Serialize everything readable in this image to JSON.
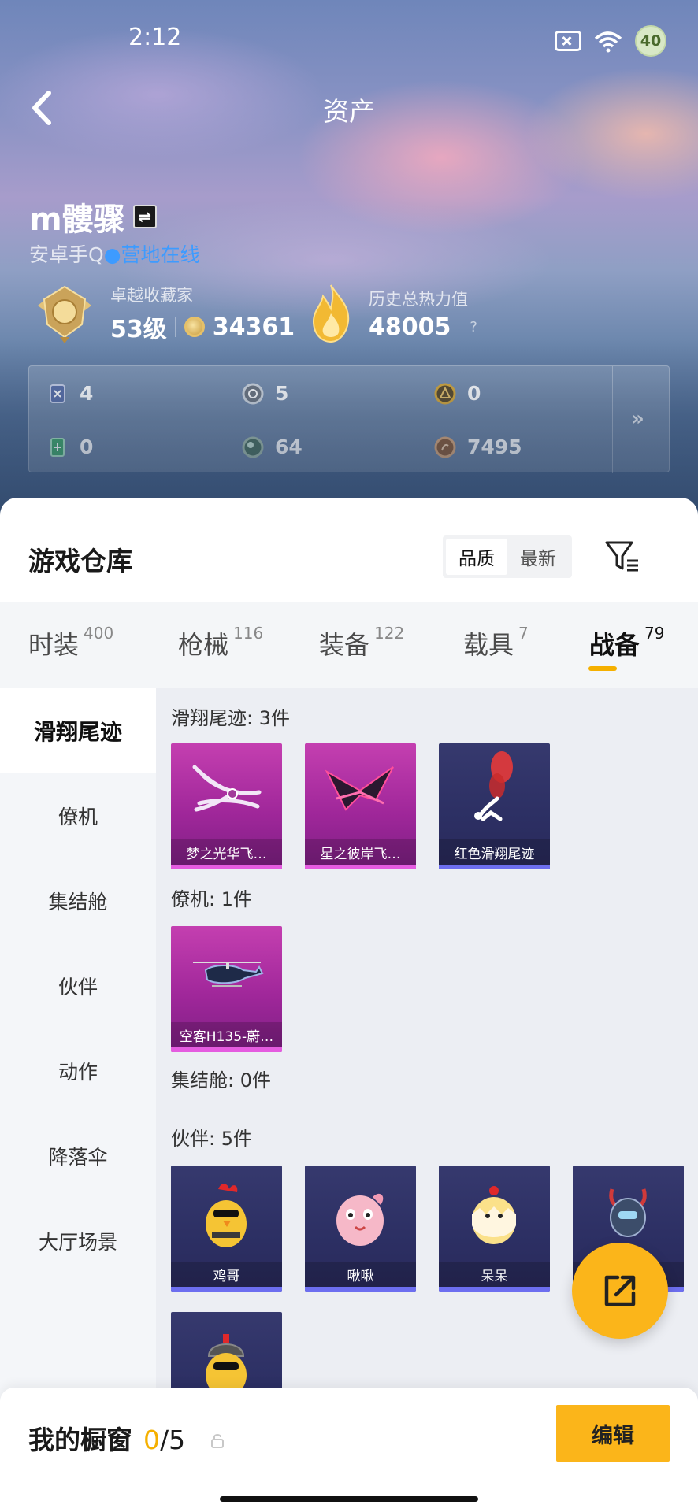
{
  "status_bar": {
    "time": "2:12",
    "battery": "40",
    "signal_sub": "6"
  },
  "header": {
    "title": "资产"
  },
  "profile": {
    "name": "m髏骤",
    "switch_symbol": "⇌",
    "platform": "安卓手Q",
    "online_status": "营地在线",
    "collector_title": "卓越收藏家",
    "level": "53级",
    "collect_points": "34361",
    "heat_label": "历史总热力值",
    "heat_value": "48005",
    "heat_help": "?"
  },
  "currencies": [
    {
      "icon": "card-icon",
      "value": "4",
      "color": "#5a6fa8"
    },
    {
      "icon": "silver-coin-icon",
      "value": "5",
      "color": "#9aa4b0"
    },
    {
      "icon": "gold-token-icon",
      "value": "0",
      "color": "#d6a83a"
    },
    {
      "icon": "green-card-icon",
      "value": "0",
      "color": "#3fa66a"
    },
    {
      "icon": "green-orb-icon",
      "value": "64",
      "color": "#5f8f78"
    },
    {
      "icon": "bronze-coin-icon",
      "value": "7495",
      "color": "#b57a4a"
    }
  ],
  "more_symbol": "»",
  "warehouse": {
    "title": "游戏仓库",
    "sort_options": [
      "品质",
      "最新"
    ],
    "active_sort": "品质"
  },
  "tabs": [
    {
      "label": "时装",
      "count": "400"
    },
    {
      "label": "枪械",
      "count": "116"
    },
    {
      "label": "装备",
      "count": "122"
    },
    {
      "label": "载具",
      "count": "7"
    },
    {
      "label": "战备",
      "count": "79"
    }
  ],
  "active_tab": "战备",
  "side_menu": [
    "滑翔尾迹",
    "僚机",
    "集结舱",
    "伙伴",
    "动作",
    "降落伞",
    "大厅场景"
  ],
  "sections": [
    {
      "title": "滑翔尾迹: 3件",
      "items": [
        {
          "name": "梦之光华飞…",
          "rarity": "purple"
        },
        {
          "name": "星之彼岸飞…",
          "rarity": "purple"
        },
        {
          "name": "红色滑翔尾迹",
          "rarity": "blue"
        }
      ]
    },
    {
      "title": "僚机: 1件",
      "items": [
        {
          "name": "空客H135-蔚…",
          "rarity": "purple"
        }
      ]
    },
    {
      "title": "集结舱: 0件",
      "items": []
    },
    {
      "title": "伙伴: 5件",
      "items": [
        {
          "name": "鸡哥",
          "rarity": "blue"
        },
        {
          "name": "啾啾",
          "rarity": "blue"
        },
        {
          "name": "呆呆",
          "rarity": "blue"
        },
        {
          "name": "",
          "rarity": "blue"
        },
        {
          "name": "",
          "rarity": "blue"
        }
      ]
    }
  ],
  "showcase": {
    "label": "我的橱窗",
    "current": "0",
    "total": "/5"
  },
  "edit_label": "编辑",
  "colors": {
    "accent": "#fbb51a",
    "online": "#3d9bff",
    "purple_rarity": "#c43fb0",
    "blue_rarity": "#6d6ef0"
  }
}
